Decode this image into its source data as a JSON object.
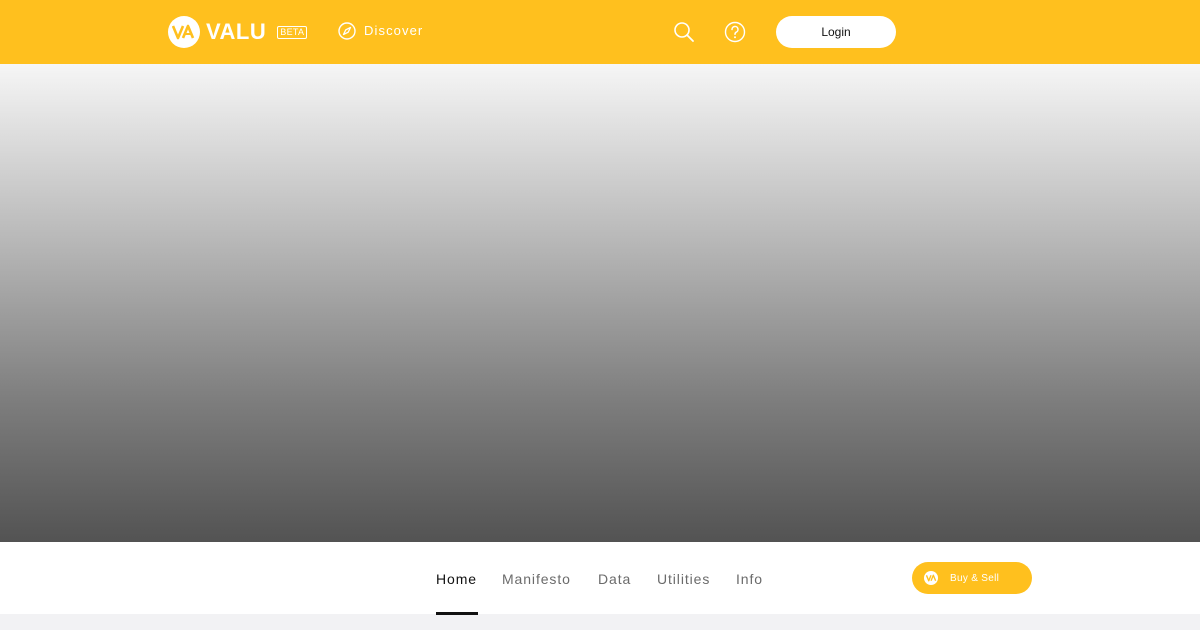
{
  "header": {
    "brand": "VALU",
    "beta_badge": "BETA",
    "nav_discover": "Discover",
    "login_label": "Login",
    "icons": {
      "discover": "compass-icon",
      "search": "search-icon",
      "help": "help-icon"
    }
  },
  "tabs": [
    {
      "label": "Home",
      "active": true
    },
    {
      "label": "Manifesto",
      "active": false
    },
    {
      "label": "Data",
      "active": false
    },
    {
      "label": "Utilities",
      "active": false
    },
    {
      "label": "Info",
      "active": false
    }
  ],
  "actions": {
    "buy_sell_label": "Buy & Sell"
  },
  "colors": {
    "brand": "#ffc01e",
    "text_active": "#111111",
    "text_muted": "#6b6b6b"
  }
}
